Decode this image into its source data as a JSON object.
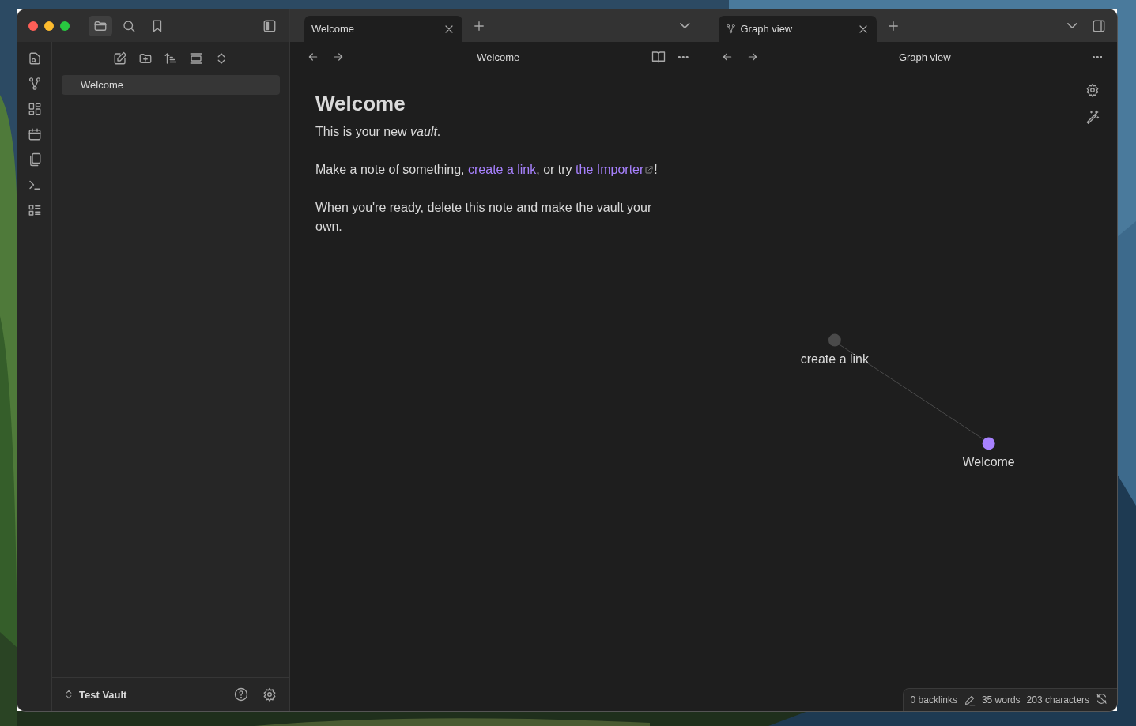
{
  "sidebar_tabs": [
    {
      "selected": true
    },
    {
      "selected": false
    },
    {
      "selected": false
    }
  ],
  "file_tree": [
    {
      "label": "Welcome",
      "selected": true
    }
  ],
  "vault": {
    "name": "Test Vault"
  },
  "panes": [
    {
      "tab": {
        "label": "Welcome",
        "kind": "note",
        "selected": true
      },
      "header": "Welcome",
      "kind": "note",
      "note": {
        "title": "Welcome",
        "paragraphs": [
          {
            "parts": [
              {
                "kind": "text",
                "text": "This is your new *vault*."
              }
            ]
          },
          {
            "parts": [
              {
                "kind": "text",
                "text": "Make a note of something, "
              },
              {
                "kind": "internal-link",
                "text": "create a link"
              },
              {
                "kind": "text",
                "text": ", or try "
              },
              {
                "kind": "external-link",
                "text": "the Importer"
              },
              {
                "kind": "text",
                "text": "!"
              }
            ]
          },
          {
            "parts": [
              {
                "kind": "text",
                "text": "When you're ready, delete this note and make the vault your own."
              }
            ]
          }
        ]
      }
    },
    {
      "tab": {
        "label": "Graph view",
        "kind": "graph",
        "selected": true
      },
      "header": "Graph view",
      "kind": "graph",
      "graph": {
        "nodes": [
          {
            "label": "create a link",
            "color": "#4a4a4a"
          },
          {
            "label": "Welcome",
            "color": "#a882ff"
          }
        ]
      }
    }
  ],
  "status_bar": {
    "backlinks": "0 backlinks",
    "words": "35 words",
    "characters": "203 characters"
  }
}
